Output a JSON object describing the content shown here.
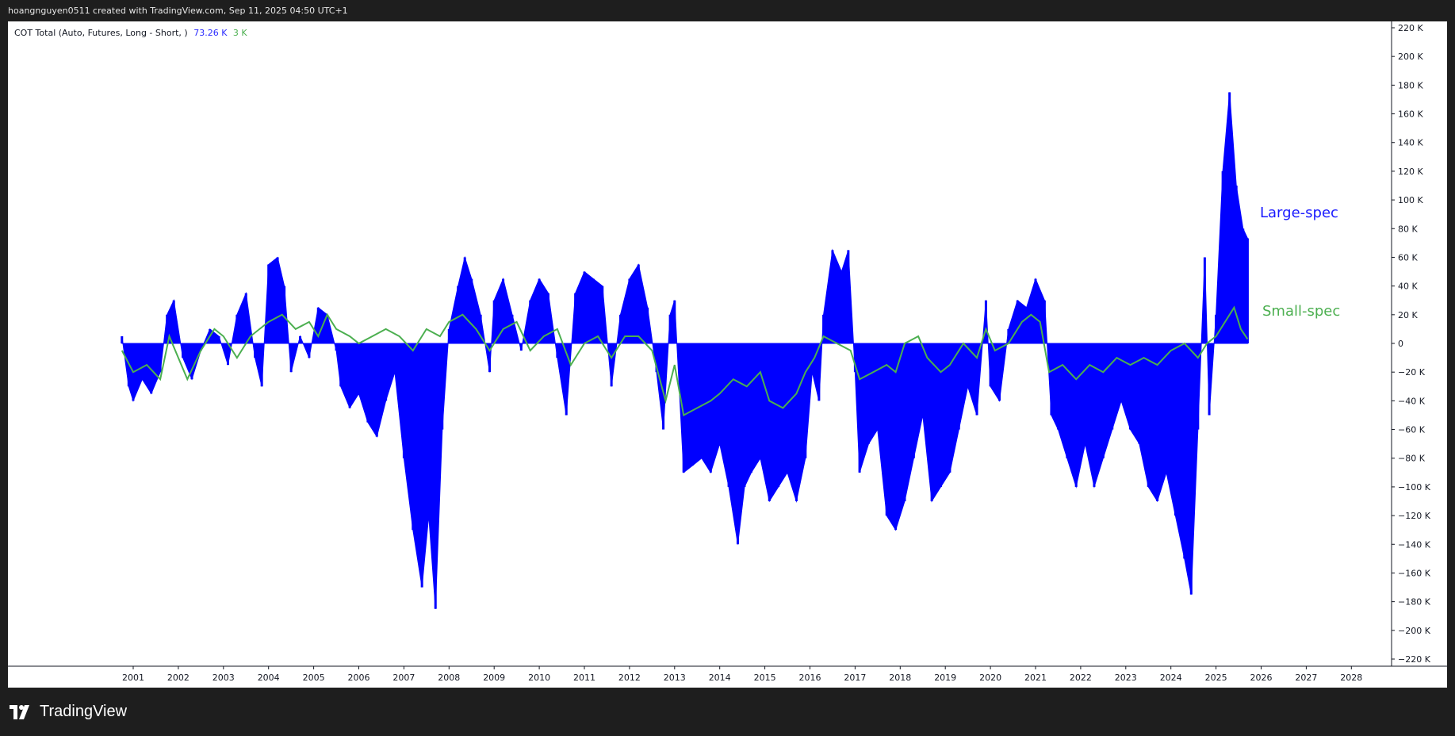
{
  "header": {
    "caption": "hoangnguyen0511 created with TradingView.com, Sep 11, 2025 04:50 UTC+1"
  },
  "legend": {
    "indicator": "COT Total (Auto, Futures, Long - Short, )",
    "value_large": "73.26 K",
    "value_small": "3 K"
  },
  "annotations": {
    "large_spec": "Large-spec",
    "small_spec": "Small-spec"
  },
  "brand": {
    "name": "TradingView"
  },
  "colors": {
    "large_spec": "#1a1aff",
    "small_spec": "#4caf50",
    "bar_fill": "#0000ff",
    "background": "#ffffff",
    "frame": "#1e1e1e"
  },
  "chart_data": {
    "type": "bar",
    "title": "",
    "xlabel": "",
    "ylabel": "",
    "x_ticks": [
      "2001",
      "2002",
      "2003",
      "2004",
      "2005",
      "2006",
      "2007",
      "2008",
      "2009",
      "2010",
      "2011",
      "2012",
      "2013",
      "2014",
      "2015",
      "2016",
      "2017",
      "2018",
      "2019",
      "2020",
      "2021",
      "2022",
      "2023",
      "2024",
      "2025",
      "2026",
      "2027",
      "2028"
    ],
    "y_ticks": [
      "220 K",
      "200 K",
      "180 K",
      "160 K",
      "140 K",
      "120 K",
      "100 K",
      "80 K",
      "60 K",
      "40 K",
      "20 K",
      "0",
      "−20 K",
      "−40 K",
      "−60 K",
      "−80 K",
      "−100 K",
      "−120 K",
      "−140 K",
      "−160 K",
      "−180 K",
      "−200 K",
      "−220 K"
    ],
    "ylim": [
      -220000,
      220000
    ],
    "xlim": [
      2000.72,
      2029.3
    ],
    "series": [
      {
        "name": "Large-spec",
        "type": "bar",
        "points": [
          [
            2000.75,
            5000
          ],
          [
            2000.9,
            -30000
          ],
          [
            2001.0,
            -40000
          ],
          [
            2001.2,
            -25000
          ],
          [
            2001.4,
            -35000
          ],
          [
            2001.6,
            -20000
          ],
          [
            2001.75,
            20000
          ],
          [
            2001.9,
            30000
          ],
          [
            2002.1,
            -10000
          ],
          [
            2002.3,
            -25000
          ],
          [
            2002.5,
            -5000
          ],
          [
            2002.7,
            10000
          ],
          [
            2002.9,
            5000
          ],
          [
            2003.1,
            -15000
          ],
          [
            2003.3,
            20000
          ],
          [
            2003.5,
            35000
          ],
          [
            2003.7,
            -10000
          ],
          [
            2003.85,
            -30000
          ],
          [
            2004.0,
            55000
          ],
          [
            2004.2,
            60000
          ],
          [
            2004.35,
            40000
          ],
          [
            2004.5,
            -20000
          ],
          [
            2004.7,
            5000
          ],
          [
            2004.9,
            -10000
          ],
          [
            2005.1,
            25000
          ],
          [
            2005.3,
            20000
          ],
          [
            2005.5,
            -5000
          ],
          [
            2005.6,
            -30000
          ],
          [
            2005.8,
            -45000
          ],
          [
            2006.0,
            -35000
          ],
          [
            2006.2,
            -55000
          ],
          [
            2006.4,
            -65000
          ],
          [
            2006.6,
            -40000
          ],
          [
            2006.8,
            -20000
          ],
          [
            2007.0,
            -80000
          ],
          [
            2007.2,
            -130000
          ],
          [
            2007.4,
            -170000
          ],
          [
            2007.55,
            -120000
          ],
          [
            2007.7,
            -185000
          ],
          [
            2007.85,
            -60000
          ],
          [
            2008.0,
            10000
          ],
          [
            2008.2,
            40000
          ],
          [
            2008.35,
            60000
          ],
          [
            2008.5,
            45000
          ],
          [
            2008.7,
            20000
          ],
          [
            2008.9,
            -20000
          ],
          [
            2009.0,
            30000
          ],
          [
            2009.2,
            45000
          ],
          [
            2009.4,
            20000
          ],
          [
            2009.6,
            -5000
          ],
          [
            2009.8,
            30000
          ],
          [
            2010.0,
            45000
          ],
          [
            2010.2,
            35000
          ],
          [
            2010.4,
            -10000
          ],
          [
            2010.6,
            -50000
          ],
          [
            2010.8,
            35000
          ],
          [
            2011.0,
            50000
          ],
          [
            2011.2,
            45000
          ],
          [
            2011.4,
            40000
          ],
          [
            2011.6,
            -30000
          ],
          [
            2011.8,
            20000
          ],
          [
            2012.0,
            45000
          ],
          [
            2012.2,
            55000
          ],
          [
            2012.4,
            25000
          ],
          [
            2012.6,
            -20000
          ],
          [
            2012.75,
            -60000
          ],
          [
            2012.9,
            20000
          ],
          [
            2013.0,
            30000
          ],
          [
            2013.2,
            -90000
          ],
          [
            2013.4,
            -85000
          ],
          [
            2013.6,
            -80000
          ],
          [
            2013.8,
            -90000
          ],
          [
            2014.0,
            -70000
          ],
          [
            2014.2,
            -100000
          ],
          [
            2014.4,
            -140000
          ],
          [
            2014.55,
            -100000
          ],
          [
            2014.7,
            -90000
          ],
          [
            2014.9,
            -80000
          ],
          [
            2015.1,
            -110000
          ],
          [
            2015.3,
            -100000
          ],
          [
            2015.5,
            -90000
          ],
          [
            2015.7,
            -110000
          ],
          [
            2015.9,
            -80000
          ],
          [
            2016.05,
            -20000
          ],
          [
            2016.2,
            -40000
          ],
          [
            2016.3,
            20000
          ],
          [
            2016.5,
            65000
          ],
          [
            2016.7,
            50000
          ],
          [
            2016.85,
            65000
          ],
          [
            2017.0,
            -20000
          ],
          [
            2017.1,
            -90000
          ],
          [
            2017.3,
            -70000
          ],
          [
            2017.5,
            -60000
          ],
          [
            2017.7,
            -120000
          ],
          [
            2017.9,
            -130000
          ],
          [
            2018.1,
            -110000
          ],
          [
            2018.3,
            -80000
          ],
          [
            2018.5,
            -50000
          ],
          [
            2018.7,
            -110000
          ],
          [
            2018.9,
            -100000
          ],
          [
            2019.1,
            -90000
          ],
          [
            2019.3,
            -60000
          ],
          [
            2019.5,
            -30000
          ],
          [
            2019.7,
            -50000
          ],
          [
            2019.9,
            30000
          ],
          [
            2020.0,
            -30000
          ],
          [
            2020.2,
            -40000
          ],
          [
            2020.4,
            10000
          ],
          [
            2020.6,
            30000
          ],
          [
            2020.8,
            25000
          ],
          [
            2021.0,
            45000
          ],
          [
            2021.2,
            30000
          ],
          [
            2021.35,
            -50000
          ],
          [
            2021.5,
            -60000
          ],
          [
            2021.7,
            -80000
          ],
          [
            2021.9,
            -100000
          ],
          [
            2022.1,
            -70000
          ],
          [
            2022.3,
            -100000
          ],
          [
            2022.5,
            -80000
          ],
          [
            2022.7,
            -60000
          ],
          [
            2022.9,
            -40000
          ],
          [
            2023.1,
            -60000
          ],
          [
            2023.3,
            -70000
          ],
          [
            2023.5,
            -100000
          ],
          [
            2023.7,
            -110000
          ],
          [
            2023.9,
            -90000
          ],
          [
            2024.1,
            -120000
          ],
          [
            2024.3,
            -150000
          ],
          [
            2024.45,
            -175000
          ],
          [
            2024.6,
            -60000
          ],
          [
            2024.75,
            60000
          ],
          [
            2024.85,
            -50000
          ],
          [
            2025.0,
            20000
          ],
          [
            2025.15,
            120000
          ],
          [
            2025.3,
            175000
          ],
          [
            2025.45,
            110000
          ],
          [
            2025.6,
            80000
          ],
          [
            2025.7,
            73260
          ]
        ]
      },
      {
        "name": "Small-spec",
        "type": "line",
        "points": [
          [
            2000.75,
            -5000
          ],
          [
            2001.0,
            -20000
          ],
          [
            2001.3,
            -15000
          ],
          [
            2001.6,
            -25000
          ],
          [
            2001.8,
            5000
          ],
          [
            2002.0,
            -10000
          ],
          [
            2002.2,
            -25000
          ],
          [
            2002.5,
            -5000
          ],
          [
            2002.8,
            10000
          ],
          [
            2003.0,
            5000
          ],
          [
            2003.3,
            -10000
          ],
          [
            2003.6,
            5000
          ],
          [
            2004.0,
            15000
          ],
          [
            2004.3,
            20000
          ],
          [
            2004.6,
            10000
          ],
          [
            2004.9,
            15000
          ],
          [
            2005.1,
            5000
          ],
          [
            2005.3,
            20000
          ],
          [
            2005.5,
            10000
          ],
          [
            2005.8,
            5000
          ],
          [
            2006.0,
            0
          ],
          [
            2006.3,
            5000
          ],
          [
            2006.6,
            10000
          ],
          [
            2006.9,
            5000
          ],
          [
            2007.2,
            -5000
          ],
          [
            2007.5,
            10000
          ],
          [
            2007.8,
            5000
          ],
          [
            2008.0,
            15000
          ],
          [
            2008.3,
            20000
          ],
          [
            2008.6,
            10000
          ],
          [
            2008.9,
            -5000
          ],
          [
            2009.2,
            10000
          ],
          [
            2009.5,
            15000
          ],
          [
            2009.8,
            -5000
          ],
          [
            2010.1,
            5000
          ],
          [
            2010.4,
            10000
          ],
          [
            2010.7,
            -15000
          ],
          [
            2011.0,
            0
          ],
          [
            2011.3,
            5000
          ],
          [
            2011.6,
            -10000
          ],
          [
            2011.9,
            5000
          ],
          [
            2012.2,
            5000
          ],
          [
            2012.5,
            -5000
          ],
          [
            2012.8,
            -40000
          ],
          [
            2013.0,
            -15000
          ],
          [
            2013.2,
            -50000
          ],
          [
            2013.5,
            -45000
          ],
          [
            2013.8,
            -40000
          ],
          [
            2014.0,
            -35000
          ],
          [
            2014.3,
            -25000
          ],
          [
            2014.6,
            -30000
          ],
          [
            2014.9,
            -20000
          ],
          [
            2015.1,
            -40000
          ],
          [
            2015.4,
            -45000
          ],
          [
            2015.7,
            -35000
          ],
          [
            2015.9,
            -20000
          ],
          [
            2016.1,
            -10000
          ],
          [
            2016.3,
            5000
          ],
          [
            2016.6,
            0
          ],
          [
            2016.9,
            -5000
          ],
          [
            2017.1,
            -25000
          ],
          [
            2017.4,
            -20000
          ],
          [
            2017.7,
            -15000
          ],
          [
            2017.9,
            -20000
          ],
          [
            2018.1,
            0
          ],
          [
            2018.4,
            5000
          ],
          [
            2018.6,
            -10000
          ],
          [
            2018.9,
            -20000
          ],
          [
            2019.1,
            -15000
          ],
          [
            2019.4,
            0
          ],
          [
            2019.7,
            -10000
          ],
          [
            2019.9,
            10000
          ],
          [
            2020.1,
            -5000
          ],
          [
            2020.4,
            0
          ],
          [
            2020.7,
            15000
          ],
          [
            2020.9,
            20000
          ],
          [
            2021.1,
            15000
          ],
          [
            2021.3,
            -20000
          ],
          [
            2021.6,
            -15000
          ],
          [
            2021.9,
            -25000
          ],
          [
            2022.2,
            -15000
          ],
          [
            2022.5,
            -20000
          ],
          [
            2022.8,
            -10000
          ],
          [
            2023.1,
            -15000
          ],
          [
            2023.4,
            -10000
          ],
          [
            2023.7,
            -15000
          ],
          [
            2024.0,
            -5000
          ],
          [
            2024.3,
            0
          ],
          [
            2024.6,
            -10000
          ],
          [
            2024.8,
            0
          ],
          [
            2025.0,
            5000
          ],
          [
            2025.2,
            15000
          ],
          [
            2025.4,
            25000
          ],
          [
            2025.55,
            10000
          ],
          [
            2025.7,
            3000
          ]
        ]
      }
    ]
  }
}
